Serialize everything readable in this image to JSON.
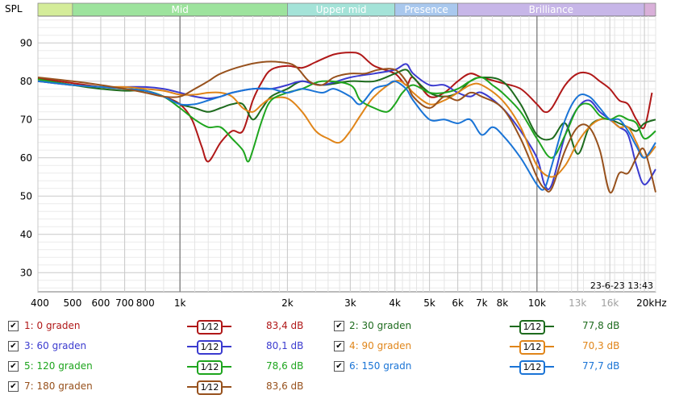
{
  "y_axis_label": "SPL",
  "timestamp": "23-6-23 13:43",
  "bands": [
    {
      "label": "",
      "from": 400,
      "to": 500,
      "color": "#d4ec99"
    },
    {
      "label": "Mid",
      "from": 500,
      "to": 2000,
      "color": "#9de39d"
    },
    {
      "label": "Upper mid",
      "from": 2000,
      "to": 4000,
      "color": "#a4e3d8"
    },
    {
      "label": "Presence",
      "from": 4000,
      "to": 6000,
      "color": "#a9c8ee"
    },
    {
      "label": "Brilliance",
      "from": 6000,
      "to": 20000,
      "color": "#c7b6e8"
    },
    {
      "label": "",
      "from": 20000,
      "to": 21500,
      "color": "#d9b0d9"
    }
  ],
  "x_ticks": [
    {
      "value": 400,
      "label": "400",
      "dim": false
    },
    {
      "value": 500,
      "label": "500",
      "dim": false
    },
    {
      "value": 600,
      "label": "600",
      "dim": false
    },
    {
      "value": 700,
      "label": "700",
      "dim": false
    },
    {
      "value": 800,
      "label": "800",
      "dim": false
    },
    {
      "value": 1000,
      "label": "1k",
      "dim": false
    },
    {
      "value": 2000,
      "label": "2k",
      "dim": false
    },
    {
      "value": 3000,
      "label": "3k",
      "dim": false
    },
    {
      "value": 4000,
      "label": "4k",
      "dim": false
    },
    {
      "value": 5000,
      "label": "5k",
      "dim": false
    },
    {
      "value": 6000,
      "label": "6k",
      "dim": false
    },
    {
      "value": 7000,
      "label": "7k",
      "dim": false
    },
    {
      "value": 8000,
      "label": "8k",
      "dim": false
    },
    {
      "value": 10000,
      "label": "10k",
      "dim": false
    },
    {
      "value": 13000,
      "label": "13k",
      "dim": true
    },
    {
      "value": 16000,
      "label": "16k",
      "dim": true
    },
    {
      "value": 20000,
      "label": "20kHz",
      "dim": false
    }
  ],
  "y_ticks": [
    30,
    40,
    50,
    60,
    70,
    80,
    90
  ],
  "chart_data": {
    "type": "line",
    "x_scale": "log",
    "xlim": [
      400,
      21500
    ],
    "ylim": [
      25,
      97
    ],
    "ylabel": "SPL",
    "grid": true,
    "series": [
      {
        "name": "1: 0 graden",
        "color": "#b01818",
        "x": [
          400,
          500,
          600,
          700,
          800,
          900,
          1000,
          1080,
          1150,
          1200,
          1300,
          1400,
          1500,
          1600,
          1700,
          1800,
          2000,
          2200,
          2400,
          2700,
          3000,
          3200,
          3500,
          4000,
          4300,
          4500,
          5000,
          5500,
          6000,
          6500,
          7000,
          8000,
          9000,
          10000,
          10500,
          11000,
          12000,
          13000,
          14000,
          15000,
          16000,
          17000,
          18000,
          19000,
          20000,
          21000
        ],
        "y": [
          80.8,
          79.5,
          78.5,
          78,
          77.5,
          76,
          74,
          70,
          63,
          59,
          64,
          67,
          67,
          75,
          80,
          83,
          84,
          83.5,
          85,
          87,
          87.5,
          87,
          84,
          82,
          79,
          81,
          76,
          77,
          80,
          82,
          81,
          79.5,
          78,
          74,
          72,
          73,
          79,
          82,
          82,
          80,
          78,
          75,
          74,
          70,
          68,
          77
        ]
      },
      {
        "name": "2: 30 graden",
        "color": "#1e6b1e",
        "x": [
          400,
          500,
          600,
          700,
          800,
          900,
          1000,
          1100,
          1200,
          1300,
          1400,
          1500,
          1600,
          1700,
          1800,
          2000,
          2200,
          2500,
          3000,
          3500,
          4000,
          4300,
          4500,
          5000,
          5500,
          6000,
          6500,
          7000,
          8000,
          9000,
          10000,
          11000,
          12000,
          13000,
          14000,
          15000,
          16000,
          17000,
          18000,
          19000,
          20000,
          21500
        ],
        "y": [
          80.5,
          79,
          78,
          77.5,
          77.5,
          76,
          74,
          73,
          72,
          73,
          74,
          74,
          70,
          73,
          76,
          78,
          80,
          79,
          80,
          80,
          82,
          83,
          81,
          77,
          76,
          77,
          80,
          81,
          80,
          74,
          66,
          65,
          69,
          61,
          68,
          70,
          70,
          69,
          68,
          67,
          69,
          70
        ]
      },
      {
        "name": "3: 60 graden",
        "color": "#3b3bcf",
        "x": [
          400,
          500,
          600,
          700,
          800,
          900,
          1000,
          1100,
          1200,
          1300,
          1400,
          1600,
          1800,
          2000,
          2200,
          2500,
          3000,
          3500,
          4000,
          4300,
          4500,
          5000,
          5500,
          6000,
          6500,
          7000,
          8000,
          9000,
          10000,
          10500,
          11000,
          12000,
          13000,
          14000,
          15000,
          16000,
          17000,
          18000,
          19000,
          20000,
          21500
        ],
        "y": [
          80,
          79,
          78.5,
          78.5,
          78.5,
          78,
          77,
          76,
          75.5,
          76,
          77,
          78,
          78,
          79,
          80,
          79,
          81,
          82,
          83,
          84.5,
          82,
          79,
          79,
          77,
          76,
          77,
          73,
          67,
          60,
          53,
          53,
          66,
          73,
          75,
          72,
          70,
          68,
          66,
          58,
          53,
          57
        ]
      },
      {
        "name": "4: 90 graden",
        "color": "#e08519",
        "x": [
          400,
          500,
          600,
          700,
          800,
          900,
          1000,
          1100,
          1200,
          1300,
          1400,
          1500,
          1600,
          1700,
          1800,
          2000,
          2200,
          2400,
          2600,
          2800,
          3000,
          3200,
          3500,
          4000,
          4300,
          4500,
          5000,
          5500,
          6000,
          6500,
          7000,
          8000,
          9000,
          10000,
          11000,
          12000,
          13000,
          14000,
          15000,
          16000,
          17000,
          18000,
          19000,
          20000,
          21500
        ],
        "y": [
          80,
          79,
          78.5,
          78.5,
          78,
          77.5,
          76.5,
          76.5,
          77,
          77,
          76,
          73,
          72,
          74,
          75.5,
          75.5,
          72,
          67,
          65,
          64,
          67,
          71,
          76,
          80,
          79,
          77,
          74,
          75,
          77,
          79,
          79,
          75,
          68,
          58,
          55,
          58,
          64,
          68,
          70,
          70,
          68,
          68,
          64,
          60,
          63
        ]
      },
      {
        "name": "5: 120 graden",
        "color": "#1ea51e",
        "x": [
          400,
          500,
          600,
          700,
          800,
          900,
          1000,
          1100,
          1200,
          1300,
          1400,
          1500,
          1550,
          1600,
          1700,
          1800,
          2000,
          2200,
          2500,
          3000,
          3200,
          3500,
          3800,
          4000,
          4200,
          4500,
          5000,
          5500,
          6000,
          6500,
          7000,
          7500,
          8000,
          9000,
          10000,
          11000,
          12000,
          13000,
          14000,
          15000,
          16000,
          17000,
          18000,
          19000,
          20000,
          21500
        ],
        "y": [
          80.5,
          79,
          78.5,
          78,
          77.5,
          76,
          73,
          70,
          68,
          68,
          65,
          62,
          59,
          62,
          70,
          75,
          77,
          78,
          80,
          79,
          75,
          73,
          72,
          74,
          77,
          79,
          77,
          77,
          78,
          80,
          81,
          79,
          77,
          72,
          65,
          60,
          66,
          73,
          74,
          71,
          70,
          71,
          70,
          69,
          65,
          67
        ]
      },
      {
        "name": "6: 150 gradn",
        "color": "#1a74d6",
        "x": [
          400,
          500,
          600,
          700,
          800,
          900,
          1000,
          1100,
          1200,
          1300,
          1400,
          1600,
          1800,
          2000,
          2200,
          2500,
          2700,
          3000,
          3200,
          3500,
          3800,
          4000,
          4300,
          4500,
          5000,
          5500,
          6000,
          6500,
          7000,
          7500,
          8000,
          9000,
          10000,
          10500,
          11000,
          12000,
          13000,
          14000,
          15000,
          16000,
          17000,
          18000,
          19000,
          20000,
          21500
        ],
        "y": [
          80,
          79,
          78.5,
          78,
          77.5,
          76,
          74,
          74,
          75,
          76,
          77,
          78,
          78,
          77,
          78,
          77,
          78,
          76,
          74,
          78,
          79,
          80,
          78,
          75,
          70,
          70,
          69,
          70,
          66,
          68,
          66,
          60,
          53,
          52,
          58,
          70,
          76,
          76,
          73,
          70,
          70,
          67,
          63,
          60,
          64
        ]
      },
      {
        "name": "7: 180 graden",
        "color": "#97511d",
        "x": [
          400,
          500,
          600,
          700,
          800,
          900,
          1000,
          1100,
          1200,
          1300,
          1500,
          1700,
          1900,
          2100,
          2300,
          2500,
          2700,
          3000,
          3300,
          3600,
          4000,
          4300,
          4500,
          5000,
          5500,
          6000,
          6500,
          7000,
          8000,
          9000,
          10000,
          10500,
          11000,
          12000,
          13000,
          14000,
          15000,
          16000,
          17000,
          18000,
          19000,
          20000,
          21500
        ],
        "y": [
          81,
          80,
          79,
          78,
          77,
          76,
          76,
          78,
          80,
          82,
          84,
          85,
          85,
          84,
          80,
          79,
          81,
          82,
          82,
          83,
          83,
          80,
          76,
          73,
          76,
          75,
          77,
          76,
          73,
          65,
          55,
          52,
          52,
          62,
          68,
          68,
          62,
          51,
          56,
          56,
          60,
          62,
          51
        ]
      }
    ]
  },
  "legend": [
    {
      "label": "1: 0 graden",
      "smoothing": "1⁄12",
      "value": "83,4 dB",
      "color": "#b01818",
      "checked": "✔"
    },
    {
      "label": "2: 30 graden",
      "smoothing": "1⁄12",
      "value": "77,8 dB",
      "color": "#1e6b1e",
      "checked": "✔"
    },
    {
      "label": "3: 60 graden",
      "smoothing": "1⁄12",
      "value": "80,1 dB",
      "color": "#3b3bcf",
      "checked": "✔"
    },
    {
      "label": "4: 90 graden",
      "smoothing": "1⁄12",
      "value": "70,3 dB",
      "color": "#e08519",
      "checked": "✔"
    },
    {
      "label": "5: 120 graden",
      "smoothing": "1⁄12",
      "value": "78,6 dB",
      "color": "#1ea51e",
      "checked": "✔"
    },
    {
      "label": "6: 150 gradn",
      "smoothing": "1⁄12",
      "value": "77,7 dB",
      "color": "#1a74d6",
      "checked": "✔"
    },
    {
      "label": "7: 180 graden",
      "smoothing": "1⁄12",
      "value": "83,6 dB",
      "color": "#97511d",
      "checked": "✔"
    }
  ]
}
